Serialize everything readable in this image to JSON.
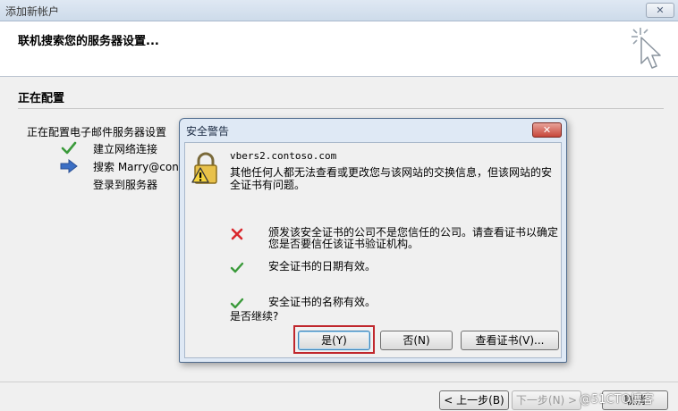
{
  "window": {
    "title": "添加新帐户",
    "close_glyph": "✕"
  },
  "header": {
    "title": "联机搜索您的服务器设置..."
  },
  "section": {
    "title": "正在配置"
  },
  "progress": {
    "intro": "正在配置电子邮件服务器设置",
    "steps": [
      {
        "label": "建立网络连接",
        "status": "done",
        "icon": "check-icon"
      },
      {
        "label": "搜索 Marry@contoso.com 服务器设置",
        "status": "current",
        "icon": "arrow-right-icon"
      },
      {
        "label": "登录到服务器",
        "status": "pending",
        "icon": ""
      }
    ]
  },
  "footer": {
    "back_label": "< 上一步(B)",
    "next_label": "下一步(N) >",
    "cancel_label": "取消"
  },
  "watermark": "@51CTO博客",
  "dialog": {
    "title": "安全警告",
    "close_glyph": "✕",
    "host": "vbers2.contoso.com",
    "message": "其他任何人都无法查看或更改您与该网站的交换信息，但该网站的安全证书有问题。",
    "checks": [
      {
        "status": "fail",
        "icon": "red-x-icon",
        "text": "颁发该安全证书的公司不是您信任的公司。请查看证书以确定您是否要信任该证书验证机构。"
      },
      {
        "status": "ok",
        "icon": "green-check-icon",
        "text": "安全证书的日期有效。"
      },
      {
        "status": "ok",
        "icon": "green-check-icon",
        "text": "安全证书的名称有效。"
      }
    ],
    "question": "是否继续?",
    "yes_label": "是(Y)",
    "no_label": "否(N)",
    "view_cert_label": "查看证书(V)..."
  },
  "colors": {
    "error": "#d9262b",
    "ok": "#3a9a3a",
    "highlight": "#c0272d",
    "arrow": "#3b6fc4"
  }
}
